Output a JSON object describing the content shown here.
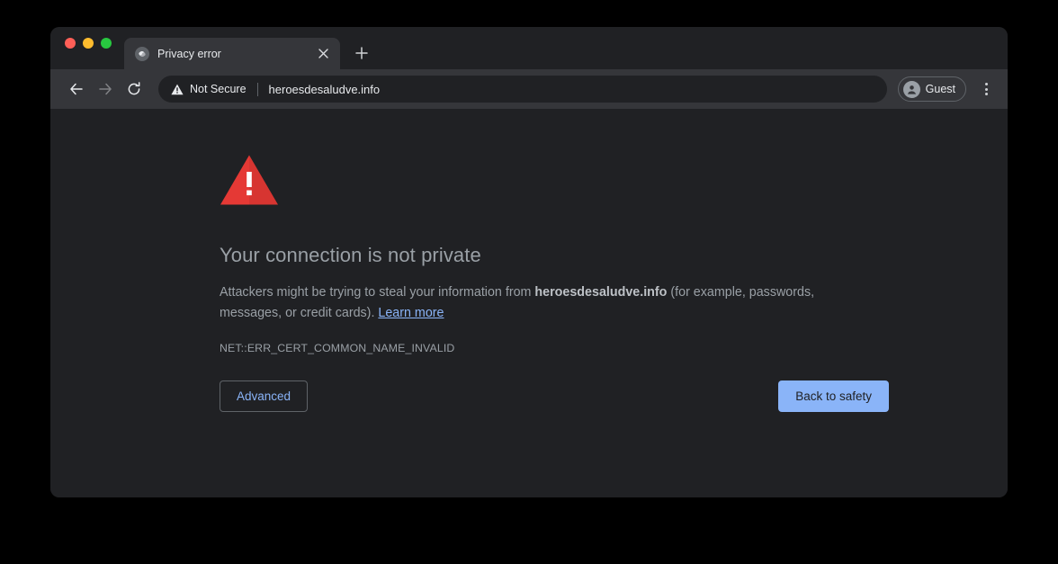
{
  "window": {
    "traffic_lights": [
      {
        "name": "close",
        "color": "#ff5f57"
      },
      {
        "name": "minimize",
        "color": "#febc2e"
      },
      {
        "name": "maximize",
        "color": "#28c840"
      }
    ]
  },
  "tab_strip": {
    "tab": {
      "title": "Privacy error",
      "favicon": "globe-placeholder-icon",
      "close_icon": "close-icon"
    },
    "new_tab_icon": "plus-icon"
  },
  "toolbar": {
    "back_icon": "back-arrow-icon",
    "forward_icon": "forward-arrow-icon",
    "reload_icon": "reload-icon",
    "omnibox": {
      "security_icon": "warning-triangle-icon",
      "security_label": "Not Secure",
      "url": "heroesdesaludve.info"
    },
    "profile": {
      "avatar_icon": "person-icon",
      "label": "Guest"
    },
    "menu_icon": "three-dot-menu-icon"
  },
  "interstitial": {
    "icon": "red-warning-triangle-icon",
    "heading": "Your connection is not private",
    "body_part1": "Attackers might be trying to steal your information from ",
    "body_domain": "heroesdesaludve.info",
    "body_part2": " (for example, passwords, messages, or credit cards). ",
    "learn_more": "Learn more",
    "error_code": "NET::ERR_CERT_COMMON_NAME_INVALID",
    "advanced_button": "Advanced",
    "safety_button": "Back to safety"
  },
  "colors": {
    "accent_blue": "#8ab4f8",
    "warning_red": "#e53935",
    "toolbar_bg": "#35363a",
    "page_bg": "#202124",
    "text_muted": "#9aa0a6"
  }
}
